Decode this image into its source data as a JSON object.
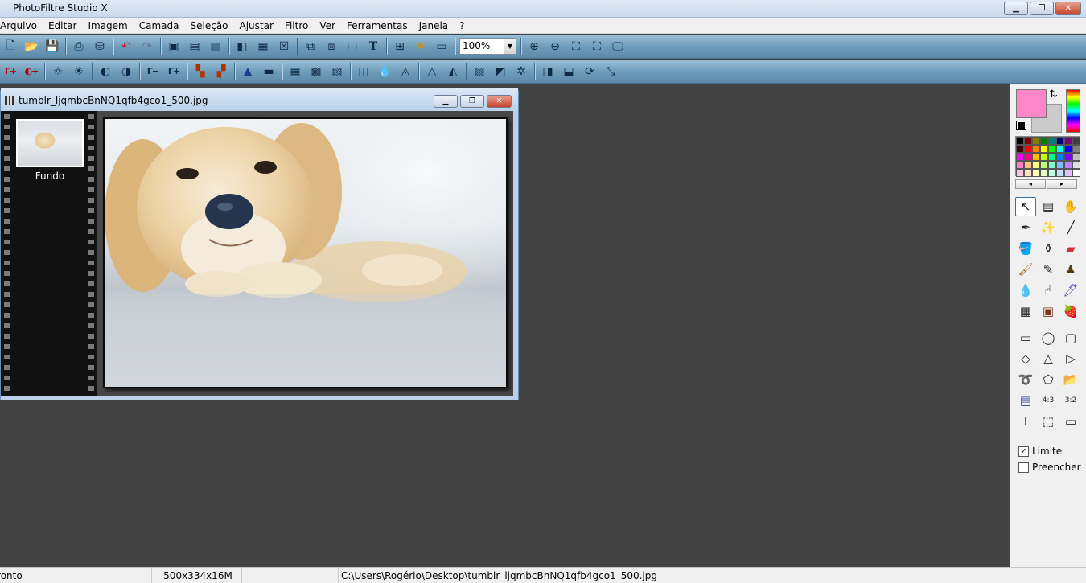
{
  "app": {
    "title": "PhotoFiltre Studio X",
    "window_controls": {
      "minimize": "▁",
      "maximize": "❐",
      "close": "✕"
    }
  },
  "menu": [
    "Arquivo",
    "Editar",
    "Imagem",
    "Camada",
    "Seleção",
    "Ajustar",
    "Filtro",
    "Ver",
    "Ferramentas",
    "Janela",
    "?"
  ],
  "toolbar1": {
    "left_icons": [
      "new-file-icon",
      "open-folder-icon",
      "save-icon",
      "print-icon",
      "scanner-icon",
      "undo-icon",
      "redo-icon",
      "paste-image-icon",
      "copy-image-icon",
      "crop-image-icon",
      "gradient-icon",
      "color-channels-icon",
      "transparency-icon",
      "layer-copy-icon",
      "layer-paste-icon",
      "selection-icon",
      "text-icon",
      "layer-manager-icon",
      "automate-icon",
      "batch-window-icon"
    ],
    "zoom_value": "100%",
    "right_icons": [
      "zoom-in-icon",
      "zoom-out-icon",
      "fit-window-icon",
      "fit-image-icon",
      "full-screen-icon"
    ]
  },
  "toolbar2": {
    "icons": [
      "auto-levels-icon",
      "auto-contrast-icon",
      "brightness-minus-icon",
      "brightness-plus-icon",
      "contrast-minus-icon",
      "contrast-plus-icon",
      "gamma-minus-icon",
      "gamma-plus-icon",
      "saturation-minus-icon",
      "saturation-plus-icon",
      "histogram-icon",
      "color-balance-icon",
      "mosaic-icon",
      "dots-icon",
      "texture-icon",
      "emboss-icon",
      "blur-icon",
      "blur-more-icon",
      "sharpen-icon",
      "sharpen-more-icon",
      "rainbow-icon",
      "gradient-filter-icon",
      "magic-icon",
      "mirror-icon",
      "flip-icon",
      "rotate-icon",
      "resize-icon"
    ]
  },
  "document": {
    "title": "tumblr_ljqmbcBnNQ1qfb4gco1_500.jpg",
    "layer_name": "Fundo"
  },
  "colors": {
    "foreground": "#fb87c9",
    "background": "#cbcbcb",
    "palette": [
      "#000000",
      "#7f0000",
      "#7f7f00",
      "#007f00",
      "#007f7f",
      "#00007f",
      "#7f007f",
      "#404040",
      "#3f0000",
      "#ff0000",
      "#ff7f00",
      "#ffff00",
      "#00ff00",
      "#00ffff",
      "#0000ff",
      "#808080",
      "#ff00ff",
      "#ff007f",
      "#ffbf00",
      "#bfff00",
      "#00ff7f",
      "#007fff",
      "#7f00ff",
      "#c0c0c0",
      "#ff7fbf",
      "#ffbf7f",
      "#ffff7f",
      "#bfff7f",
      "#7fffbf",
      "#7fbfff",
      "#bf7fff",
      "#e0e0e0",
      "#ffc0e0",
      "#ffe0c0",
      "#ffffc0",
      "#e0ffc0",
      "#c0ffe0",
      "#c0e0ff",
      "#e0c0ff",
      "#ffffff"
    ]
  },
  "tools": [
    "pointer-icon",
    "selection-window-icon",
    "hand-icon",
    "eyedropper-icon",
    "magic-wand-icon",
    "line-icon",
    "bucket-fill-icon",
    "spray-icon",
    "eraser-icon",
    "brush-icon",
    "advanced-brush-icon",
    "stamp-icon",
    "blur-drop-icon",
    "smudge-icon",
    "deform-icon",
    "pattern-icon",
    "clone-icon",
    "strawberry-icon"
  ],
  "shapes": [
    "rectangle-icon",
    "ellipse-icon",
    "rounded-rect-icon",
    "diamond-icon",
    "triangle-icon",
    "arrow-triangle-icon",
    "lasso-icon",
    "polygon-icon",
    "open-shape-icon",
    "hide-selection-icon",
    "ratio-4-3-icon",
    "ratio-3-2-icon",
    "fixed-size-icon",
    "fit-selection-icon",
    "selection-settings-icon"
  ],
  "options": {
    "limit_label": "Limite",
    "limit_checked": true,
    "fill_label": "Preencher",
    "fill_checked": false
  },
  "status": {
    "state": "Pronto",
    "dimensions": "500x334x16M",
    "path": "C:\\Users\\Rogério\\Desktop\\tumblr_ljqmbcBnNQ1qfb4gco1_500.jpg"
  }
}
